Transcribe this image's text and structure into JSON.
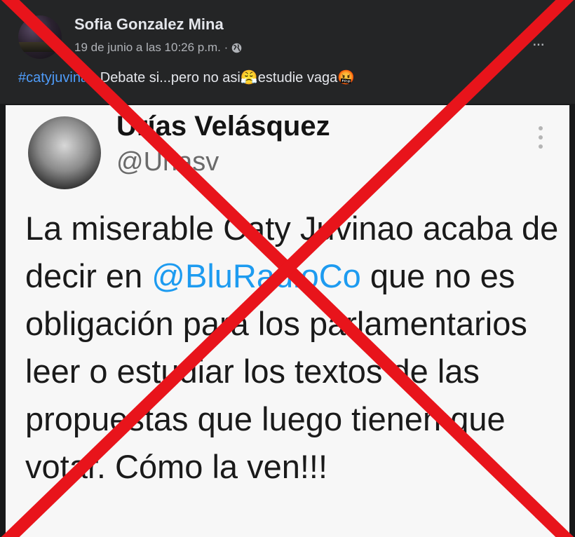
{
  "post": {
    "author": "Sofia Gonzalez Mina",
    "timestamp": "19 de junio a las 10:26 p.m. ·",
    "hashtag": "#catyjuvinao",
    "text": " Debate si...pero no asi",
    "emoji_1": "😤",
    "text_2": "estudie vaga",
    "emoji_2": "🤬",
    "more_label": "..."
  },
  "tweet": {
    "name": "Urías Velásquez",
    "handle": "@Uriasv",
    "body_before": "La miserable Caty Juvinao acaba de decir en ",
    "mention": "@BluRadioCo",
    "body_after": " que no es obligación para los parlamentarios leer o estudiar los textos de las propuestas que luego tienen que votar. Cómo la ven!!!"
  },
  "overlay": {
    "cross_color": "#e8141b"
  }
}
